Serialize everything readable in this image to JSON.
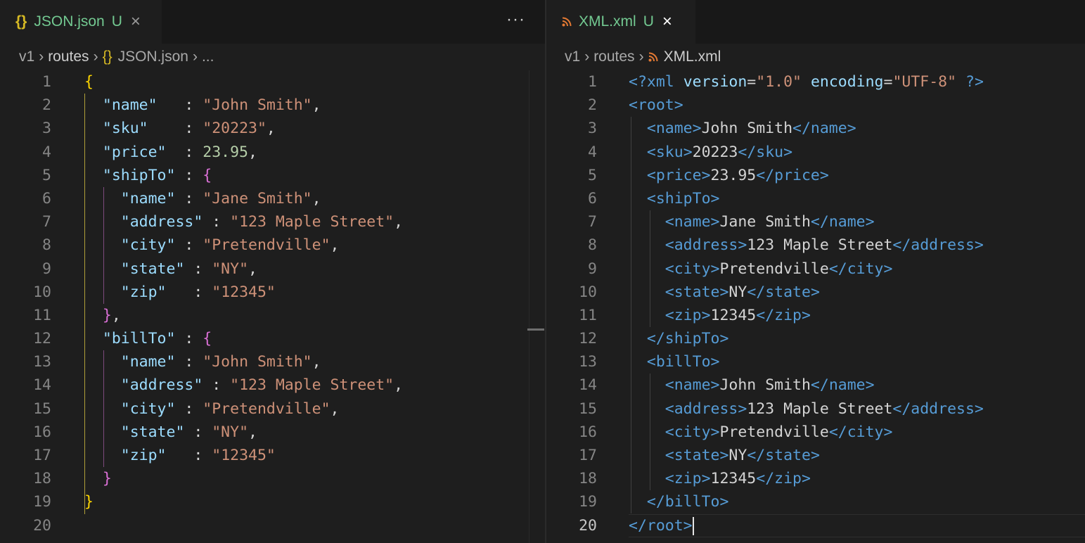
{
  "left": {
    "tab": {
      "icon": "{}",
      "name": "JSON.json",
      "status": "U",
      "close": "×"
    },
    "more": "···",
    "breadcrumb": {
      "icon": "{}",
      "items": [
        "v1",
        "routes",
        "JSON.json",
        "..."
      ]
    },
    "lines": [
      [
        [
          "b1",
          "{"
        ]
      ],
      [
        [
          "p",
          "  "
        ],
        [
          "k",
          "\"name\""
        ],
        [
          "p",
          "   : "
        ],
        [
          "s",
          "\"John Smith\""
        ],
        [
          "p",
          ","
        ]
      ],
      [
        [
          "p",
          "  "
        ],
        [
          "k",
          "\"sku\""
        ],
        [
          "p",
          "    : "
        ],
        [
          "s",
          "\"20223\""
        ],
        [
          "p",
          ","
        ]
      ],
      [
        [
          "p",
          "  "
        ],
        [
          "k",
          "\"price\""
        ],
        [
          "p",
          "  : "
        ],
        [
          "n",
          "23.95"
        ],
        [
          "p",
          ","
        ]
      ],
      [
        [
          "p",
          "  "
        ],
        [
          "k",
          "\"shipTo\""
        ],
        [
          "p",
          " : "
        ],
        [
          "b2",
          "{"
        ]
      ],
      [
        [
          "p",
          "    "
        ],
        [
          "k",
          "\"name\""
        ],
        [
          "p",
          " : "
        ],
        [
          "s",
          "\"Jane Smith\""
        ],
        [
          "p",
          ","
        ]
      ],
      [
        [
          "p",
          "    "
        ],
        [
          "k",
          "\"address\""
        ],
        [
          "p",
          " : "
        ],
        [
          "s",
          "\"123 Maple Street\""
        ],
        [
          "p",
          ","
        ]
      ],
      [
        [
          "p",
          "    "
        ],
        [
          "k",
          "\"city\""
        ],
        [
          "p",
          " : "
        ],
        [
          "s",
          "\"Pretendville\""
        ],
        [
          "p",
          ","
        ]
      ],
      [
        [
          "p",
          "    "
        ],
        [
          "k",
          "\"state\""
        ],
        [
          "p",
          " : "
        ],
        [
          "s",
          "\"NY\""
        ],
        [
          "p",
          ","
        ]
      ],
      [
        [
          "p",
          "    "
        ],
        [
          "k",
          "\"zip\""
        ],
        [
          "p",
          "   : "
        ],
        [
          "s",
          "\"12345\""
        ]
      ],
      [
        [
          "p",
          "  "
        ],
        [
          "b2",
          "}"
        ],
        [
          "p",
          ","
        ]
      ],
      [
        [
          "p",
          "  "
        ],
        [
          "k",
          "\"billTo\""
        ],
        [
          "p",
          " : "
        ],
        [
          "b2",
          "{"
        ]
      ],
      [
        [
          "p",
          "    "
        ],
        [
          "k",
          "\"name\""
        ],
        [
          "p",
          " : "
        ],
        [
          "s",
          "\"John Smith\""
        ],
        [
          "p",
          ","
        ]
      ],
      [
        [
          "p",
          "    "
        ],
        [
          "k",
          "\"address\""
        ],
        [
          "p",
          " : "
        ],
        [
          "s",
          "\"123 Maple Street\""
        ],
        [
          "p",
          ","
        ]
      ],
      [
        [
          "p",
          "    "
        ],
        [
          "k",
          "\"city\""
        ],
        [
          "p",
          " : "
        ],
        [
          "s",
          "\"Pretendville\""
        ],
        [
          "p",
          ","
        ]
      ],
      [
        [
          "p",
          "    "
        ],
        [
          "k",
          "\"state\""
        ],
        [
          "p",
          " : "
        ],
        [
          "s",
          "\"NY\""
        ],
        [
          "p",
          ","
        ]
      ],
      [
        [
          "p",
          "    "
        ],
        [
          "k",
          "\"zip\""
        ],
        [
          "p",
          "   : "
        ],
        [
          "s",
          "\"12345\""
        ]
      ],
      [
        [
          "p",
          "  "
        ],
        [
          "b2",
          "}"
        ]
      ],
      [
        [
          "b1",
          "}"
        ]
      ],
      []
    ]
  },
  "right": {
    "tab": {
      "name": "XML.xml",
      "status": "U",
      "close": "×"
    },
    "breadcrumb": {
      "items": [
        "v1",
        "routes",
        "XML.xml"
      ]
    },
    "current_line": 20,
    "lines": [
      [
        [
          "tg",
          "<?"
        ],
        [
          "tn",
          "xml"
        ],
        [
          "p",
          " "
        ],
        [
          "at",
          "version"
        ],
        [
          "p",
          "="
        ],
        [
          "s",
          "\"1.0\""
        ],
        [
          "p",
          " "
        ],
        [
          "at",
          "encoding"
        ],
        [
          "p",
          "="
        ],
        [
          "s",
          "\"UTF-8\""
        ],
        [
          "p",
          " "
        ],
        [
          "tg",
          "?>"
        ]
      ],
      [
        [
          "tg",
          "<"
        ],
        [
          "tn",
          "root"
        ],
        [
          "tg",
          ">"
        ]
      ],
      [
        [
          "p",
          "  "
        ],
        [
          "tg",
          "<"
        ],
        [
          "tn",
          "name"
        ],
        [
          "tg",
          ">"
        ],
        [
          "tx",
          "John Smith"
        ],
        [
          "tg",
          "</"
        ],
        [
          "tn",
          "name"
        ],
        [
          "tg",
          ">"
        ]
      ],
      [
        [
          "p",
          "  "
        ],
        [
          "tg",
          "<"
        ],
        [
          "tn",
          "sku"
        ],
        [
          "tg",
          ">"
        ],
        [
          "tx",
          "20223"
        ],
        [
          "tg",
          "</"
        ],
        [
          "tn",
          "sku"
        ],
        [
          "tg",
          ">"
        ]
      ],
      [
        [
          "p",
          "  "
        ],
        [
          "tg",
          "<"
        ],
        [
          "tn",
          "price"
        ],
        [
          "tg",
          ">"
        ],
        [
          "tx",
          "23.95"
        ],
        [
          "tg",
          "</"
        ],
        [
          "tn",
          "price"
        ],
        [
          "tg",
          ">"
        ]
      ],
      [
        [
          "p",
          "  "
        ],
        [
          "tg",
          "<"
        ],
        [
          "tn",
          "shipTo"
        ],
        [
          "tg",
          ">"
        ]
      ],
      [
        [
          "p",
          "    "
        ],
        [
          "tg",
          "<"
        ],
        [
          "tn",
          "name"
        ],
        [
          "tg",
          ">"
        ],
        [
          "tx",
          "Jane Smith"
        ],
        [
          "tg",
          "</"
        ],
        [
          "tn",
          "name"
        ],
        [
          "tg",
          ">"
        ]
      ],
      [
        [
          "p",
          "    "
        ],
        [
          "tg",
          "<"
        ],
        [
          "tn",
          "address"
        ],
        [
          "tg",
          ">"
        ],
        [
          "tx",
          "123 Maple Street"
        ],
        [
          "tg",
          "</"
        ],
        [
          "tn",
          "address"
        ],
        [
          "tg",
          ">"
        ]
      ],
      [
        [
          "p",
          "    "
        ],
        [
          "tg",
          "<"
        ],
        [
          "tn",
          "city"
        ],
        [
          "tg",
          ">"
        ],
        [
          "tx",
          "Pretendville"
        ],
        [
          "tg",
          "</"
        ],
        [
          "tn",
          "city"
        ],
        [
          "tg",
          ">"
        ]
      ],
      [
        [
          "p",
          "    "
        ],
        [
          "tg",
          "<"
        ],
        [
          "tn",
          "state"
        ],
        [
          "tg",
          ">"
        ],
        [
          "tx",
          "NY"
        ],
        [
          "tg",
          "</"
        ],
        [
          "tn",
          "state"
        ],
        [
          "tg",
          ">"
        ]
      ],
      [
        [
          "p",
          "    "
        ],
        [
          "tg",
          "<"
        ],
        [
          "tn",
          "zip"
        ],
        [
          "tg",
          ">"
        ],
        [
          "tx",
          "12345"
        ],
        [
          "tg",
          "</"
        ],
        [
          "tn",
          "zip"
        ],
        [
          "tg",
          ">"
        ]
      ],
      [
        [
          "p",
          "  "
        ],
        [
          "tg",
          "</"
        ],
        [
          "tn",
          "shipTo"
        ],
        [
          "tg",
          ">"
        ]
      ],
      [
        [
          "p",
          "  "
        ],
        [
          "tg",
          "<"
        ],
        [
          "tn",
          "billTo"
        ],
        [
          "tg",
          ">"
        ]
      ],
      [
        [
          "p",
          "    "
        ],
        [
          "tg",
          "<"
        ],
        [
          "tn",
          "name"
        ],
        [
          "tg",
          ">"
        ],
        [
          "tx",
          "John Smith"
        ],
        [
          "tg",
          "</"
        ],
        [
          "tn",
          "name"
        ],
        [
          "tg",
          ">"
        ]
      ],
      [
        [
          "p",
          "    "
        ],
        [
          "tg",
          "<"
        ],
        [
          "tn",
          "address"
        ],
        [
          "tg",
          ">"
        ],
        [
          "tx",
          "123 Maple Street"
        ],
        [
          "tg",
          "</"
        ],
        [
          "tn",
          "address"
        ],
        [
          "tg",
          ">"
        ]
      ],
      [
        [
          "p",
          "    "
        ],
        [
          "tg",
          "<"
        ],
        [
          "tn",
          "city"
        ],
        [
          "tg",
          ">"
        ],
        [
          "tx",
          "Pretendville"
        ],
        [
          "tg",
          "</"
        ],
        [
          "tn",
          "city"
        ],
        [
          "tg",
          ">"
        ]
      ],
      [
        [
          "p",
          "    "
        ],
        [
          "tg",
          "<"
        ],
        [
          "tn",
          "state"
        ],
        [
          "tg",
          ">"
        ],
        [
          "tx",
          "NY"
        ],
        [
          "tg",
          "</"
        ],
        [
          "tn",
          "state"
        ],
        [
          "tg",
          ">"
        ]
      ],
      [
        [
          "p",
          "    "
        ],
        [
          "tg",
          "<"
        ],
        [
          "tn",
          "zip"
        ],
        [
          "tg",
          ">"
        ],
        [
          "tx",
          "12345"
        ],
        [
          "tg",
          "</"
        ],
        [
          "tn",
          "zip"
        ],
        [
          "tg",
          ">"
        ]
      ],
      [
        [
          "p",
          "  "
        ],
        [
          "tg",
          "</"
        ],
        [
          "tn",
          "billTo"
        ],
        [
          "tg",
          ">"
        ]
      ],
      [
        [
          "tg",
          "</"
        ],
        [
          "tn",
          "root"
        ],
        [
          "tg",
          ">"
        ]
      ]
    ]
  }
}
